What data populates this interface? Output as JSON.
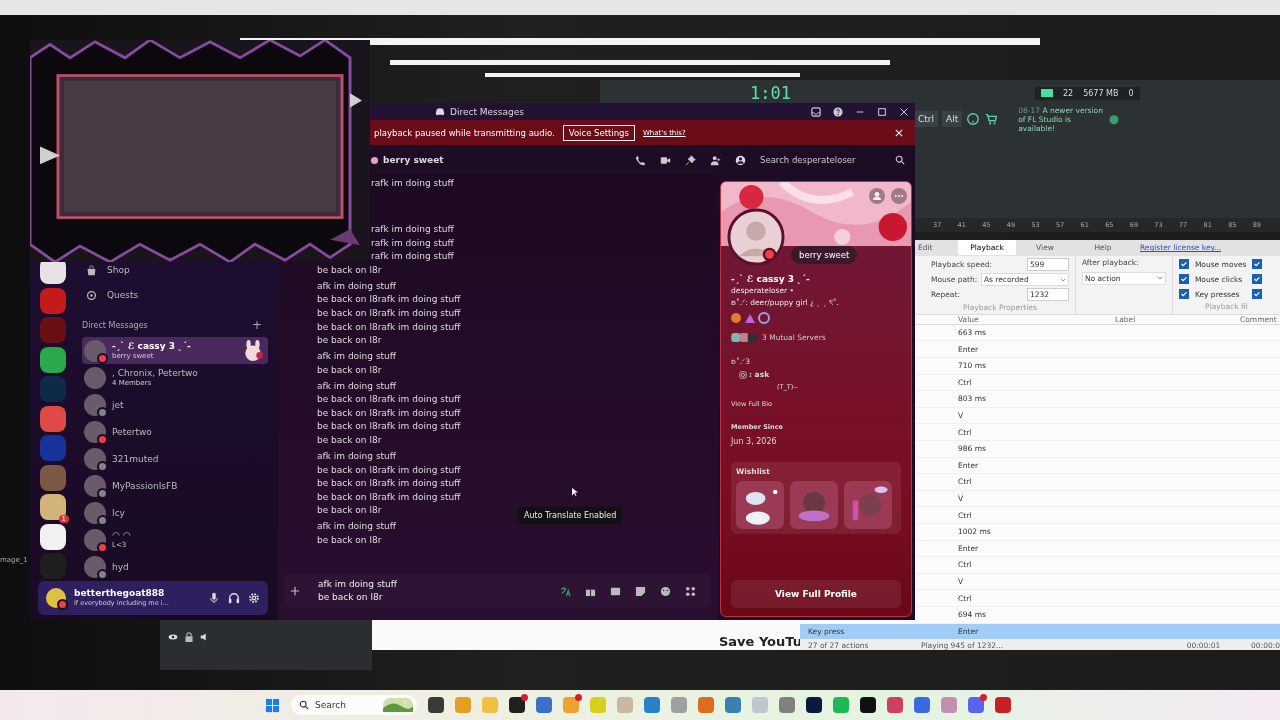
{
  "fl_studio": {
    "clock": "1:01",
    "cpu": "22",
    "memory": "5677 MB",
    "polyphony": "0",
    "keys": [
      "Ctrl",
      "Alt"
    ],
    "notice_date": "08-17",
    "notice": "A newer version of FL Studio is available!",
    "ruler": [
      "37",
      "41",
      "45",
      "49",
      "53",
      "57",
      "61",
      "65",
      "69",
      "73",
      "77",
      "81",
      "85",
      "89"
    ]
  },
  "macro_recorder": {
    "menu": [
      {
        "label": "Edit",
        "selected": false
      },
      {
        "label": "Playback",
        "selected": true
      },
      {
        "label": "View",
        "selected": false
      },
      {
        "label": "Help",
        "selected": false
      }
    ],
    "license_link": "Register license key...",
    "playback_speed_label": "Playback speed:",
    "playback_speed": "599",
    "mouse_path_label": "Mouse path:",
    "mouse_path": "As recorded",
    "repeat_label": "Repeat:",
    "repeat": "1232",
    "properties_caption": "Playback Properties",
    "after_playback_label": "After playback:",
    "after_playback": "No action",
    "filters": [
      {
        "label": "Mouse moves",
        "checked": true
      },
      {
        "label": "Mouse clicks",
        "checked": true
      },
      {
        "label": "Key presses",
        "checked": true
      }
    ],
    "filters_more": [
      {
        "checked": true
      },
      {
        "checked": true
      },
      {
        "checked": true
      }
    ],
    "filters_caption": "Playback fil",
    "columns": [
      "Value",
      "Label",
      "Comment"
    ],
    "rows": [
      {
        "value": "663 ms",
        "selected": false
      },
      {
        "value": "Enter",
        "selected": false
      },
      {
        "value": "710 ms",
        "selected": false
      },
      {
        "value": "Ctrl",
        "selected": false
      },
      {
        "value": "803 ms",
        "selected": false
      },
      {
        "value": "V",
        "selected": false
      },
      {
        "value": "Ctrl",
        "selected": false
      },
      {
        "value": "986 ms",
        "selected": false
      },
      {
        "value": "Enter",
        "selected": false
      },
      {
        "value": "Ctrl",
        "selected": false
      },
      {
        "value": "V",
        "selected": false
      },
      {
        "value": "Ctrl",
        "selected": false
      },
      {
        "value": "1002 ms",
        "selected": false
      },
      {
        "value": "Enter",
        "selected": false
      },
      {
        "value": "Ctrl",
        "selected": false
      },
      {
        "value": "V",
        "selected": false
      },
      {
        "value": "Ctrl",
        "selected": false
      },
      {
        "value": "694 ms",
        "selected": false
      },
      {
        "value": "Enter",
        "action": "Key press",
        "selected": true
      }
    ],
    "status_left": "27 of 27 actions",
    "status": "Playing 945 of 1232...",
    "elapsed": "00:00:01",
    "total": "00:00:0"
  },
  "background_window": {
    "text": "Save YouTu"
  },
  "desktop_label": "mage_1",
  "discord": {
    "title": "Direct Messages",
    "notice": {
      "text": "playback paused while transmitting audio.",
      "button": "Voice Settings",
      "link": "What's this?"
    },
    "servers": [
      {
        "color": "#e6e2e6"
      },
      {
        "color": "#c41a1a"
      },
      {
        "color": "#6a0f14"
      },
      {
        "color": "#2aa84a"
      },
      {
        "color": "#0e2a48"
      },
      {
        "color": "#e04a46"
      },
      {
        "color": "#17339a"
      },
      {
        "color": "#7a5a44"
      },
      {
        "color": "#d2b47a",
        "badge": "1"
      },
      {
        "color": "#f2f2f2"
      },
      {
        "color": "#1e1e1e"
      }
    ],
    "nav": [
      {
        "label": "Shop",
        "kind": "shop"
      },
      {
        "label": "Quests",
        "kind": "quests"
      }
    ],
    "dm_header": "Direct Messages",
    "dm_add": "+",
    "dms": [
      {
        "name": "-ˏˋ ℰ cassy 3 ˎˊ-",
        "sub": "berry sweet",
        "color": "#f23f43",
        "selected": true
      },
      {
        "name": ", Chronix, Petertwo",
        "sub": "4 Members",
        "selected": false
      },
      {
        "name": "jet",
        "color": "#80848e",
        "selected": false
      },
      {
        "name": "Petertwo",
        "color": "#f23f43",
        "selected": false
      },
      {
        "name": "321muted",
        "color": "#80848e",
        "selected": false
      },
      {
        "name": "MyPassionIsFB",
        "color": "#80848e",
        "selected": false
      },
      {
        "name": "Icy",
        "color": "#80848e",
        "selected": false
      },
      {
        "name": "◠ ◠",
        "sub": "L<3",
        "color": "#f23f43",
        "selected": false
      },
      {
        "name": "hyd",
        "color": "#80848e",
        "selected": false
      }
    ],
    "user": {
      "name": "betterthegoat888",
      "status": "if everybody including me i..."
    },
    "chat": {
      "header": "berry sweet",
      "search_placeholder": "Search desperateloser",
      "groups": [
        [
          {
            "text": "rafk im doing stuff",
            "kind": "partial"
          }
        ],
        [
          {
            "text": "rafk im doing stuff",
            "kind": "partial"
          },
          {
            "text": "rafk im doing stuff",
            "kind": "partial"
          },
          {
            "text": "rafk im doing stuff",
            "kind": "partial"
          },
          {
            "text": "be back on l8r",
            "kind": "full"
          }
        ],
        [
          {
            "text": "afk im doing stuff",
            "kind": "full"
          },
          {
            "text": "be back on l8rafk im doing stuff",
            "kind": "full"
          },
          {
            "text": "be back on l8rafk im doing stuff",
            "kind": "full"
          },
          {
            "text": "be back on l8rafk im doing stuff",
            "kind": "full"
          },
          {
            "text": "be back on l8r",
            "kind": "full"
          }
        ],
        [
          {
            "text": "afk im doing stuff",
            "kind": "full"
          },
          {
            "text": "be back on l8r",
            "kind": "full"
          }
        ],
        [
          {
            "text": "afk im doing stuff",
            "kind": "full"
          },
          {
            "text": "be back on l8rafk im doing stuff",
            "kind": "full"
          },
          {
            "text": "be back on l8rafk im doing stuff",
            "kind": "full"
          },
          {
            "text": "be back on l8rafk im doing stuff",
            "kind": "full"
          },
          {
            "text": "be back on l8r",
            "kind": "full"
          }
        ],
        [
          {
            "text": "afk im doing stuff",
            "kind": "full"
          },
          {
            "text": "be back on l8rafk im doing stuff",
            "kind": "full"
          },
          {
            "text": "be back on l8rafk im doing stuff",
            "kind": "full"
          },
          {
            "text": "be back on l8rafk im doing stuff",
            "kind": "full"
          },
          {
            "text": "be back on l8r",
            "kind": "full"
          }
        ],
        [
          {
            "text": "afk im doing stuff",
            "kind": "full"
          },
          {
            "text": "be back on l8r",
            "kind": "full"
          }
        ]
      ],
      "tooltip": "Auto Translate Enabled",
      "composer": [
        "afk im doing stuff",
        "be back on l8r"
      ]
    },
    "profile": {
      "tag": "berry sweet",
      "name": "-ˏˋ ℰ cassy 3 ˎˊ-",
      "username": "desperateloser •",
      "pronouns": "ʚ˚.ᐟ: deer/puppy girl ¿ ˎ ˏ ৎ˚.",
      "mutual": "3 Mutual Servers",
      "bio": [
        "ʚ˚.ᐟ3",
        ": ask",
        "(T_T)--"
      ],
      "bio_link": "View Full Bio",
      "member_since_label": "Member Since",
      "member_since": "Jun 3, 2026",
      "wishlist": "Wishlist",
      "button": "View Full Profile"
    }
  },
  "taskbar": {
    "search": "Search",
    "apps": [
      {
        "color": "#3a3a3a"
      },
      {
        "color": "#e0a020"
      },
      {
        "color": "#f0c040"
      },
      {
        "color": "#202020",
        "badge": true
      },
      {
        "color": "#3a70c8"
      },
      {
        "color": "#f0a030",
        "badge": true
      },
      {
        "color": "#d8d020"
      },
      {
        "color": "#c8b8a0"
      },
      {
        "color": "#2a80c8"
      },
      {
        "color": "#a0a0a0"
      },
      {
        "color": "#e06a20"
      },
      {
        "color": "#3a80b0"
      },
      {
        "color": "#c0c8d0"
      },
      {
        "color": "#808080"
      },
      {
        "color": "#0a1a3a"
      },
      {
        "color": "#1db954"
      },
      {
        "color": "#101010"
      },
      {
        "color": "#d04060"
      },
      {
        "color": "#3a6ae0"
      },
      {
        "color": "#c090b0"
      },
      {
        "color": "#5865f2",
        "badge": true
      },
      {
        "color": "#c82020"
      }
    ]
  }
}
